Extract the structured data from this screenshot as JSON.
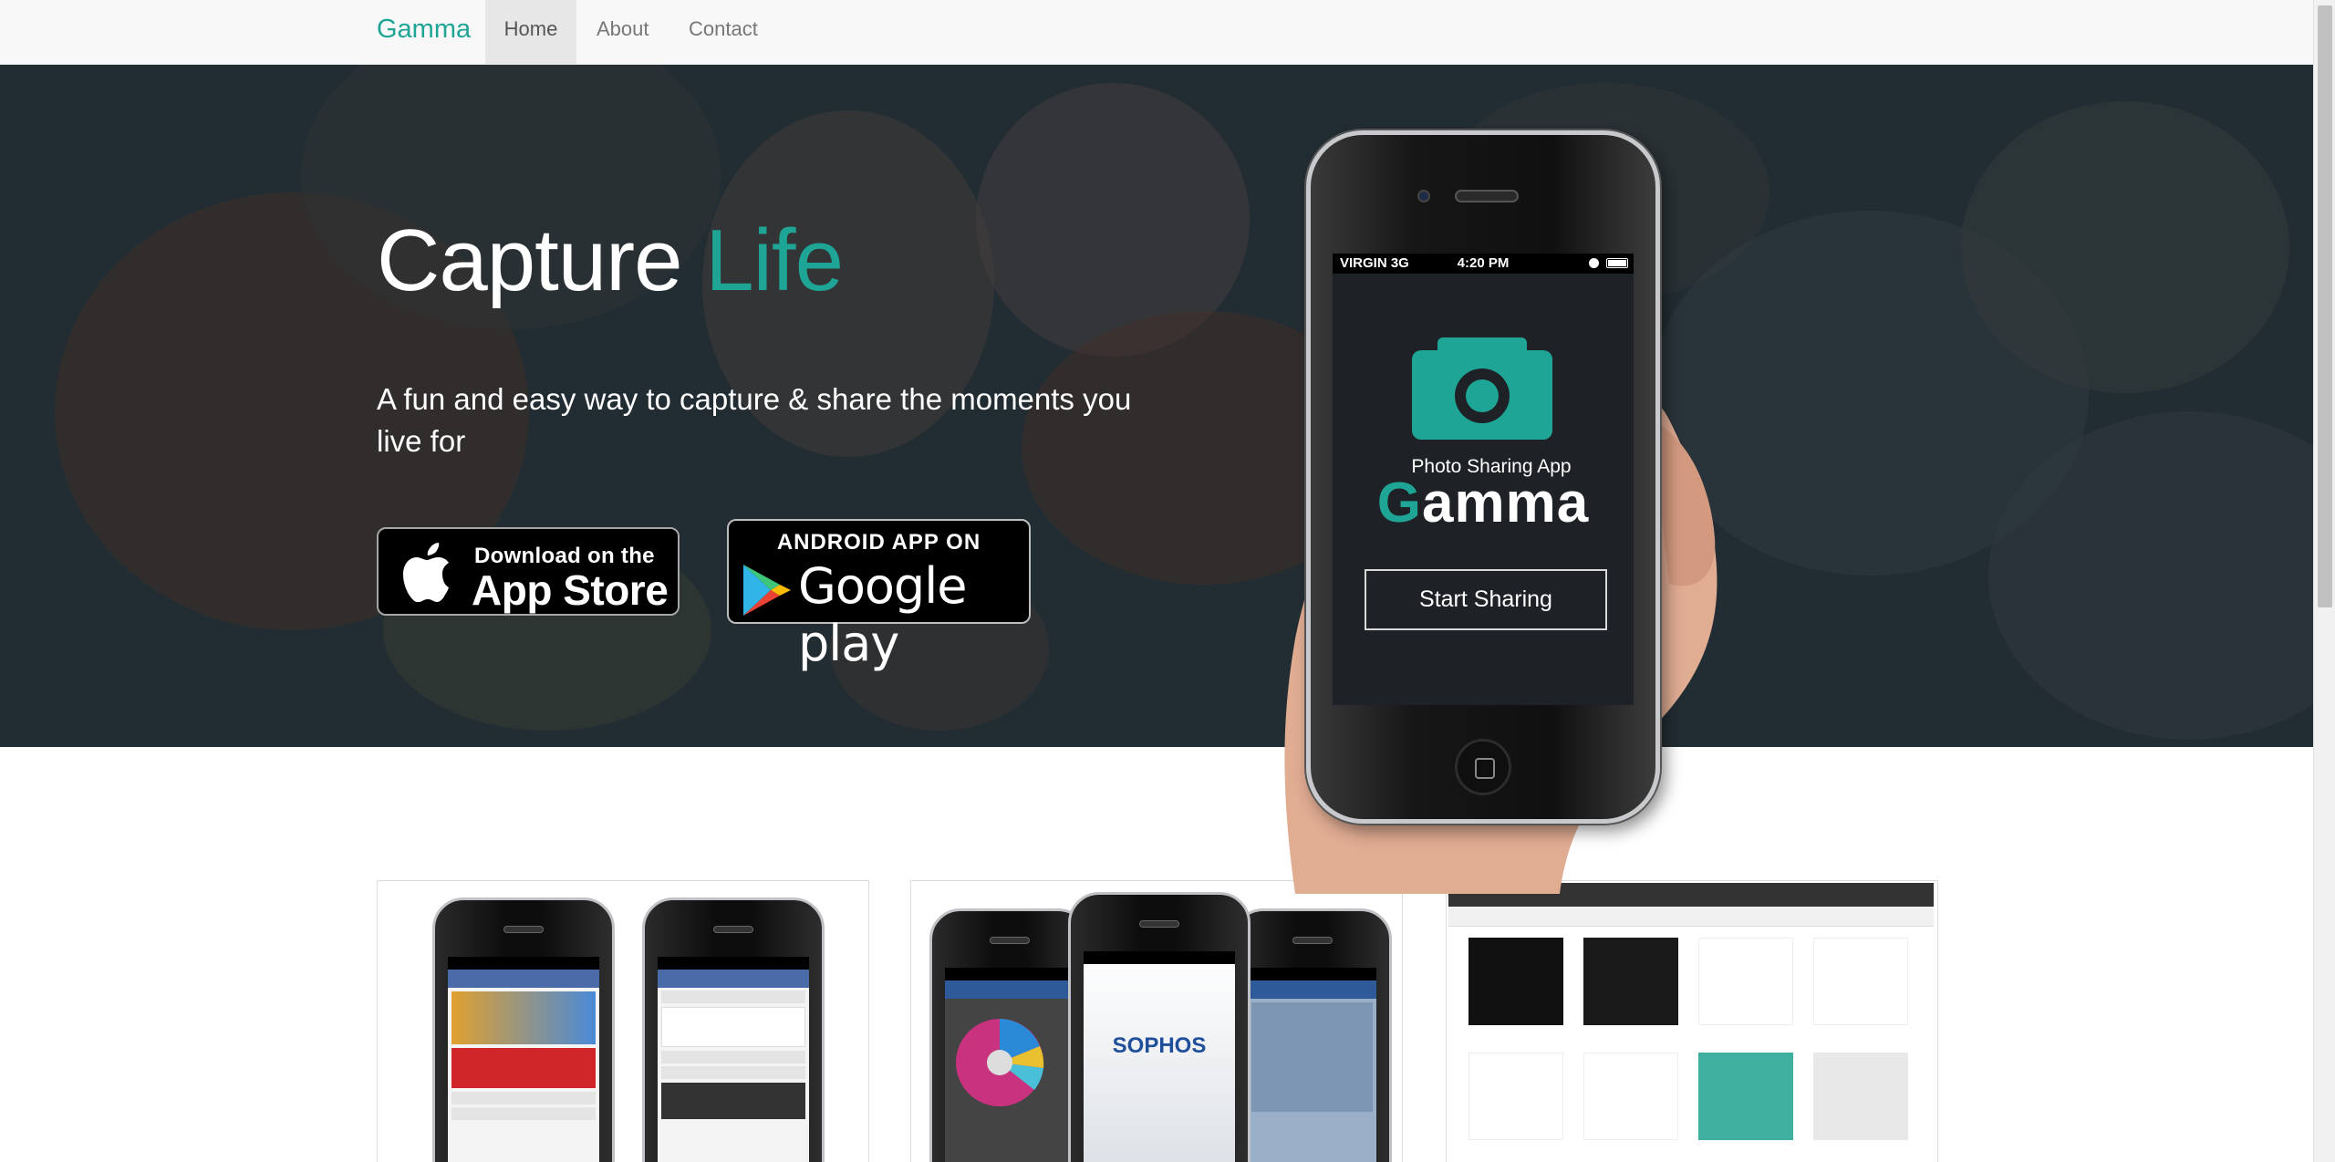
{
  "navbar": {
    "brand": "Gamma",
    "items": [
      {
        "label": "Home",
        "active": true
      },
      {
        "label": "About",
        "active": false
      },
      {
        "label": "Contact",
        "active": false
      }
    ]
  },
  "hero": {
    "headline_main": "Capture",
    "headline_accent": "Life",
    "subheadline": "A fun and easy way to capture & share the moments you live for",
    "appstore_badge": {
      "line1": "Download on the",
      "line2": "App Store",
      "icon": "apple-icon"
    },
    "googleplay_badge": {
      "line1": "ANDROID APP ON",
      "line2": "Google play",
      "icon": "google-play-icon"
    }
  },
  "phone": {
    "status_carrier": "VIRGIN  3G",
    "status_time": "4:20 PM",
    "tagline": "Photo Sharing App",
    "app_name_first": "G",
    "app_name_rest": "amma",
    "cta_label": "Start Sharing",
    "icon": "camera-icon"
  },
  "thumbnails": {
    "thumb2_brand": "SOPHOS"
  },
  "colors": {
    "accent": "#1fa596",
    "hero_bg": "#2b323d",
    "navbar_bg": "#f8f8f8"
  }
}
